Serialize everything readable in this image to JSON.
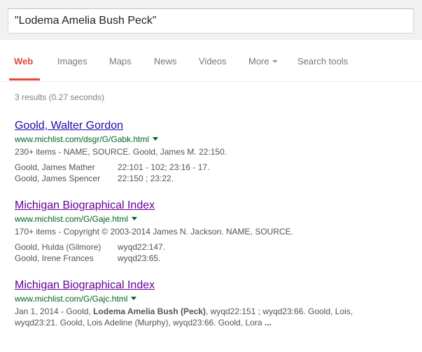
{
  "search": {
    "query": "\"Lodema Amelia Bush Peck\""
  },
  "tabs": [
    {
      "label": "Web",
      "active": true
    },
    {
      "label": "Images"
    },
    {
      "label": "Maps"
    },
    {
      "label": "News"
    },
    {
      "label": "Videos"
    },
    {
      "label": "More"
    },
    {
      "label": "Search tools"
    }
  ],
  "stats": "3 results (0.27 seconds)",
  "results": [
    {
      "title": "Goold, Walter Gordon",
      "url": "www.michlist.com/dsgr/G/Gabk.html",
      "snippet": "230+ items - NAME, SOURCE. Goold, James M. 22:150.",
      "rows": [
        {
          "name": "Goold, James Mather",
          "value": "22:101 - 102; 23:16 - 17."
        },
        {
          "name": "Goold, James Spencer",
          "value": "22:150 ; 23:22."
        }
      ]
    },
    {
      "title": "Michigan Biographical Index",
      "url": "www.michlist.com/G/Gaje.html",
      "snippet": "170+ items - Copyright © 2003-2014 James N. Jackson. NAME, SOURCE.",
      "rows": [
        {
          "name": "Goold, Hulda (Gilmore)",
          "value": "wyqd22:147."
        },
        {
          "name": "Goold, Irene Frances",
          "value": "wyqd23:65."
        }
      ]
    },
    {
      "title": "Michigan Biographical Index",
      "url": "www.michlist.com/G/Gajc.html",
      "snippet_parts": {
        "pre": "Jan 1, 2014 - Goold, ",
        "bold1": "Lodema Amelia Bush (Peck)",
        "mid": ", wyqd22:151 ; wyqd23:66. Goold, Lois, wyqd23:21. Goold, Lois Adeline (Murphy), wyqd23:66. Goold, Lora ",
        "bold2": "..."
      }
    }
  ],
  "colors": {
    "accent": "#dd4b39",
    "link": "#1a0dab",
    "visited": "#660099",
    "url": "#006621"
  }
}
